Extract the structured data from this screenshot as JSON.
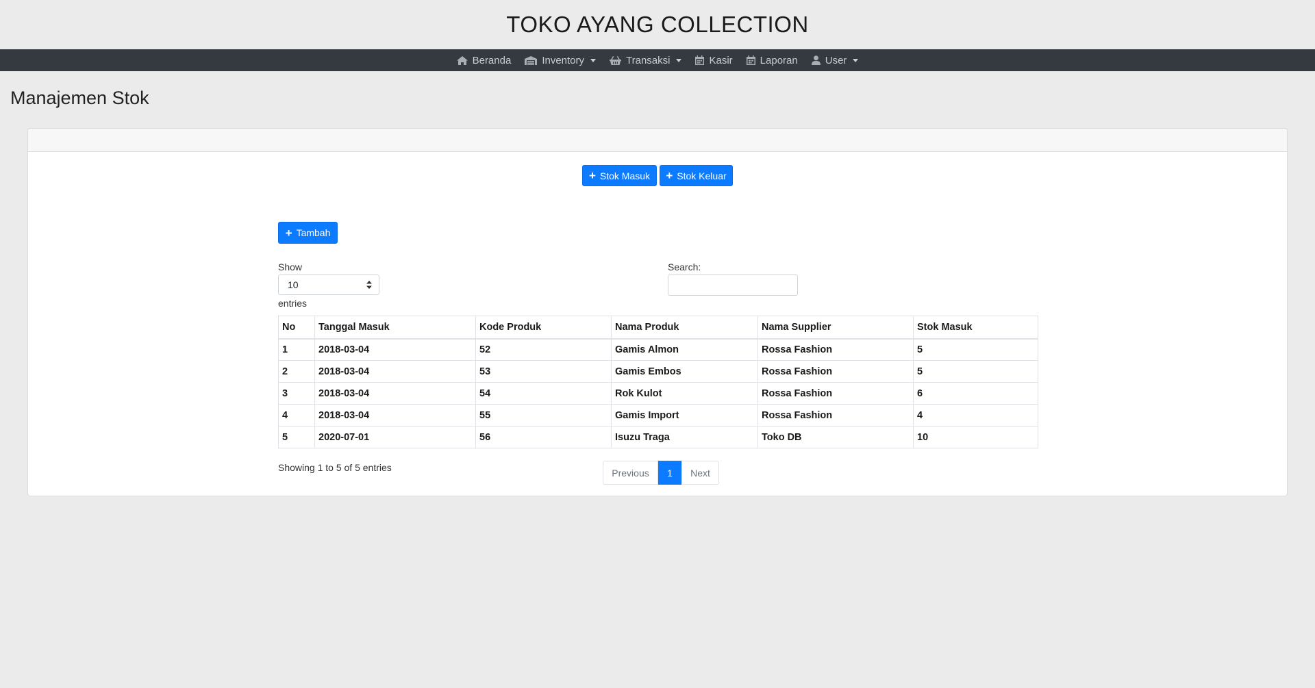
{
  "site": {
    "title": "TOKO AYANG COLLECTION"
  },
  "nav": {
    "items": [
      {
        "label": "Beranda",
        "icon": "home-icon"
      },
      {
        "label": "Inventory",
        "icon": "warehouse-icon",
        "dropdown": true
      },
      {
        "label": "Transaksi",
        "icon": "basket-icon",
        "dropdown": true
      },
      {
        "label": "Kasir",
        "icon": "calendar-icon"
      },
      {
        "label": "Laporan",
        "icon": "calendar-icon"
      },
      {
        "label": "User",
        "icon": "user-icon",
        "dropdown": true
      }
    ]
  },
  "page": {
    "heading": "Manajemen Stok"
  },
  "actions": {
    "stok_masuk": "Stok Masuk",
    "stok_keluar": "Stok Keluar",
    "tambah": "Tambah"
  },
  "datatable": {
    "show_label": "Show",
    "length_value": "10",
    "entries_label": "entries",
    "search_label": "Search:",
    "search_value": "",
    "info": "Showing 1 to 5 of 5 entries",
    "columns": [
      "No",
      "Tanggal Masuk",
      "Kode Produk",
      "Nama Produk",
      "Nama Supplier",
      "Stok Masuk"
    ],
    "rows": [
      [
        "1",
        "2018-03-04",
        "52",
        "Gamis Almon",
        "Rossa Fashion",
        "5"
      ],
      [
        "2",
        "2018-03-04",
        "53",
        "Gamis Embos",
        "Rossa Fashion",
        "5"
      ],
      [
        "3",
        "2018-03-04",
        "54",
        "Rok Kulot",
        "Rossa Fashion",
        "6"
      ],
      [
        "4",
        "2018-03-04",
        "55",
        "Gamis Import",
        "Rossa Fashion",
        "4"
      ],
      [
        "5",
        "2020-07-01",
        "56",
        "Isuzu Traga",
        "Toko DB",
        "10"
      ]
    ]
  },
  "pagination": {
    "previous": "Previous",
    "current": "1",
    "next": "Next"
  },
  "colors": {
    "primary": "#0d7bff",
    "navbar": "#343a40",
    "background": "#ebebeb"
  }
}
